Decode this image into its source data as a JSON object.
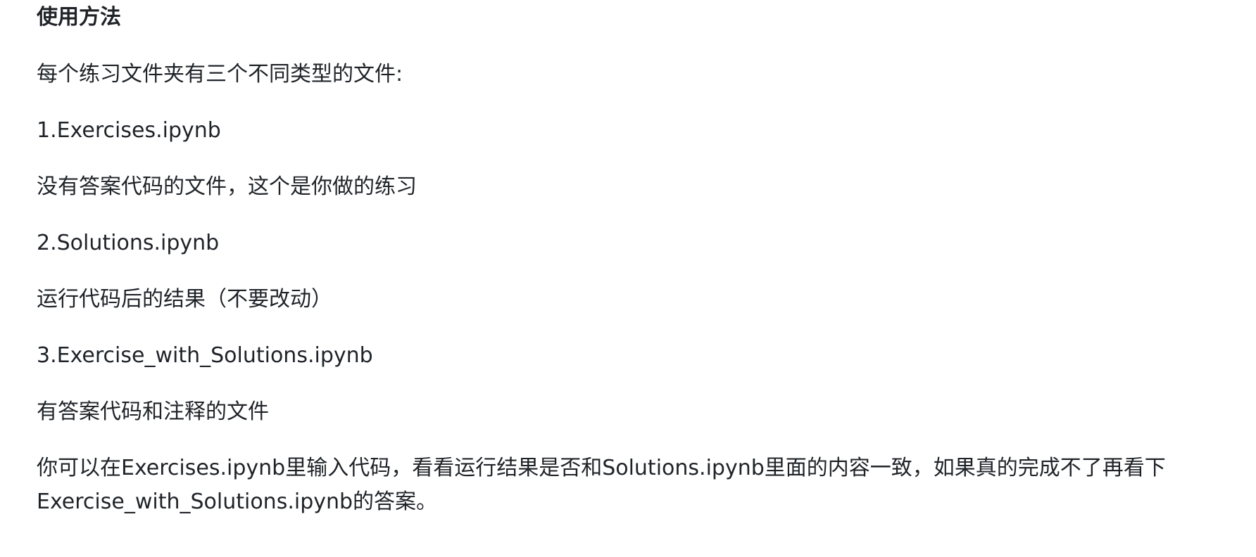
{
  "section": {
    "heading": "使用方法",
    "paragraphs": [
      "每个练习文件夹有三个不同类型的文件:",
      "1.Exercises.ipynb",
      "没有答案代码的文件，这个是你做的练习",
      "2.Solutions.ipynb",
      "运行代码后的结果（不要改动）",
      "3.Exercise_with_Solutions.ipynb",
      "有答案代码和注释的文件"
    ],
    "final_paragraph": {
      "line1": "你可以在Exercises.ipynb里输入代码，看看运行结果是否和Solutions.ipynb里面的内容一致，如果真的完成不了再看下",
      "line2": "Exercise_with_Solutions.ipynb的答案。"
    }
  }
}
